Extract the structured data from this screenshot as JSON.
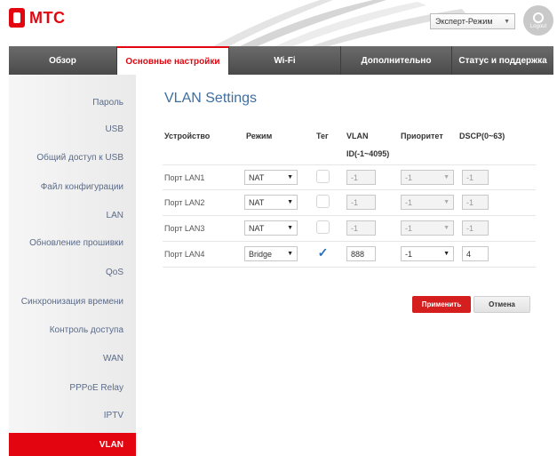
{
  "header": {
    "brand": "МТС",
    "mode_select": "Эксперт-Режим",
    "logout_label": "Logout"
  },
  "tabs": [
    {
      "label": "Обзор"
    },
    {
      "label": "Основные настройки"
    },
    {
      "label": "Wi-Fi"
    },
    {
      "label": "Дополнительно"
    },
    {
      "label": "Статус и поддержка"
    }
  ],
  "sidebar": {
    "items": [
      {
        "label": "Пароль"
      },
      {
        "label": "USB"
      },
      {
        "label": "Общий доступ к USB"
      },
      {
        "label": "Файл конфигурации"
      },
      {
        "label": "LAN"
      },
      {
        "label": "Обновление прошивки"
      },
      {
        "label": "QoS"
      },
      {
        "label": "Синхронизация времени"
      },
      {
        "label": "Контроль доступа"
      },
      {
        "label": "WAN"
      },
      {
        "label": "PPPoE Relay"
      },
      {
        "label": "IPTV"
      },
      {
        "label": "VLAN"
      }
    ]
  },
  "main": {
    "title": "VLAN Settings",
    "columns": {
      "device": "Устройство",
      "mode": "Режим",
      "tag": "Тег",
      "vlan_line1": "VLAN",
      "vlan_line2": "ID(-1~4095)",
      "priority": "Приоритет",
      "dscp": "DSCP(0~63)"
    },
    "rows": [
      {
        "device": "Порт LAN1",
        "mode": "NAT",
        "tagged": false,
        "vlan_id": "-1",
        "priority": "-1",
        "dscp": "-1"
      },
      {
        "device": "Порт LAN2",
        "mode": "NAT",
        "tagged": false,
        "vlan_id": "-1",
        "priority": "-1",
        "dscp": "-1"
      },
      {
        "device": "Порт LAN3",
        "mode": "NAT",
        "tagged": false,
        "vlan_id": "-1",
        "priority": "-1",
        "dscp": "-1"
      },
      {
        "device": "Порт LAN4",
        "mode": "Bridge",
        "tagged": true,
        "vlan_id": "888",
        "priority": "-1",
        "dscp": "4"
      }
    ],
    "apply_label": "Применить",
    "cancel_label": "Отмена"
  },
  "icons": {
    "dropdown": "chevron-down-icon",
    "check": "checkmark-icon",
    "logout": "power-icon"
  },
  "colors": {
    "brand_red": "#e30611",
    "title_blue": "#3d6fa0",
    "sidebar_link": "#5a6b8a"
  }
}
